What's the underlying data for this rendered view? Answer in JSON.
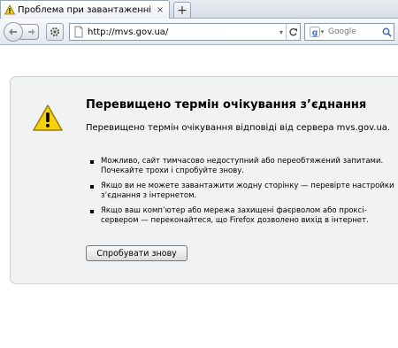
{
  "tab": {
    "title": "Проблема при завантаженні сторінки",
    "close_glyph": "×"
  },
  "newtab": {
    "glyph": "+"
  },
  "navbar": {
    "url": "http://mvs.gov.ua/",
    "search_placeholder": "Google"
  },
  "error": {
    "title": "Перевищено термін очікування з’єднання",
    "description": "Перевищено термін очікування відповіді від сервера mvs.gov.ua.",
    "suggestions": [
      "Можливо, сайт тимчасово недоступний або переобтяжений запитами. Почекайте трохи і спробуйте знову.",
      "Якщо ви не можете завантажити жодну сторінку — перевірте настройки з’єднання з інтернетом.",
      "Якщо ваш комп’ютер або мережа захищені фаєрволом або проксі-сервером — переконайтеся, що Firefox дозволено вихід в інтернет."
    ],
    "retry_label": "Спробувати знову"
  },
  "icons": {
    "tab_favicon": "warning-triangle-icon",
    "back": "back-arrow-icon",
    "forward": "forward-arrow-icon",
    "tools": "gear-icon",
    "site": "page-icon",
    "reload": "reload-icon",
    "search_engine": "google-icon",
    "search_go": "magnifier-icon",
    "error": "warning-triangle-icon"
  },
  "colors": {
    "warning_yellow": "#f5d20a",
    "error_box_bg": "#f1f2f4",
    "error_box_border": "#cdd0d4",
    "chrome_bg": "#e3e8ee"
  }
}
